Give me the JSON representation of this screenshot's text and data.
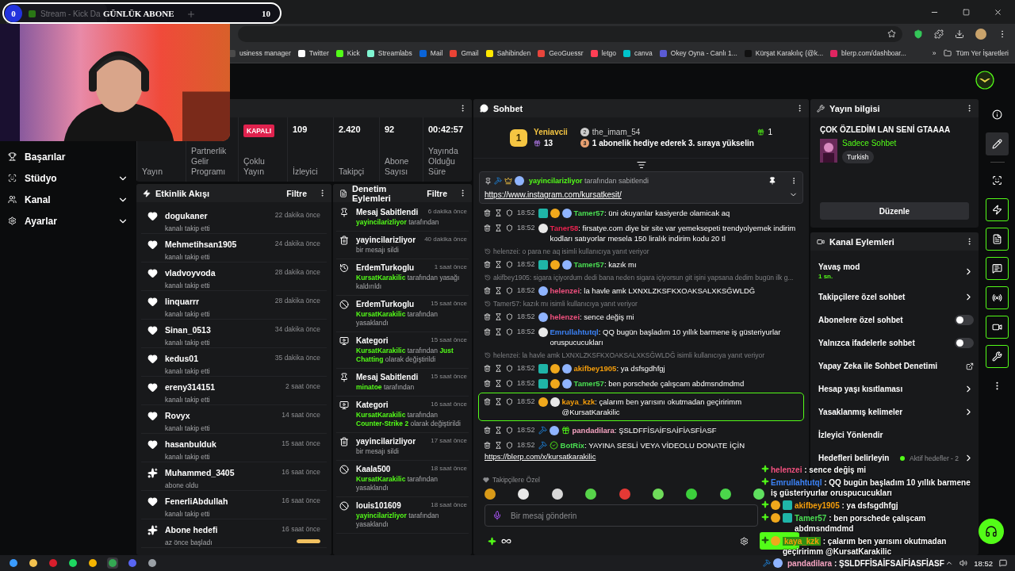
{
  "goal_overlay": {
    "current": "0",
    "label": "GÜNLÜK ABONE",
    "target": "10",
    "level": 0
  },
  "browser": {
    "tab_title": "Stream - Kick Da",
    "bookmarks": [
      {
        "label": "usiness manager",
        "color": "#4a4a4a"
      },
      {
        "label": "Twitter",
        "color": "#ffffff"
      },
      {
        "label": "Kick",
        "color": "#53fc18"
      },
      {
        "label": "Streamlabs",
        "color": "#80f5d2"
      },
      {
        "label": "Mail",
        "color": "#0a64d8"
      },
      {
        "label": "Gmail",
        "color": "#ea4335"
      },
      {
        "label": "Sahibinden",
        "color": "#ffe800"
      },
      {
        "label": "GeoGuessr",
        "color": "#e8453c"
      },
      {
        "label": "letgo",
        "color": "#ff3f55"
      },
      {
        "label": "canva",
        "color": "#00c4cc"
      },
      {
        "label": "Okey Oyna - Canlı 1...",
        "color": "#5b5bd6"
      },
      {
        "label": "Kürşat Karakılıç (@k...",
        "color": "#111111"
      },
      {
        "label": "blerp.com/dashboar...",
        "color": "#e02561"
      }
    ],
    "more": "»",
    "all_bookmarks": "Tüm Yer İşaretleri"
  },
  "sidebar": {
    "items": [
      {
        "label": "Başarılar",
        "expandable": false
      },
      {
        "label": "Stüdyo",
        "expandable": true
      },
      {
        "label": "Kanal",
        "expandable": true
      },
      {
        "label": "Ayarlar",
        "expandable": true
      }
    ]
  },
  "stats": {
    "cells": [
      {
        "kind": "text",
        "label": "Yayın"
      },
      {
        "kind": "text",
        "label": "Partnerlik Gelir Programı"
      },
      {
        "kind": "badge",
        "value": "KAPALI",
        "label": "Çoklu Yayın"
      },
      {
        "kind": "number",
        "value": "109",
        "label": "İzleyici"
      },
      {
        "kind": "number",
        "value": "2.420",
        "label": "Takipçi"
      },
      {
        "kind": "number",
        "value": "92",
        "label": "Abone Sayısı"
      },
      {
        "kind": "number",
        "value": "00:42:57",
        "label": "Yayında Olduğu Süre"
      }
    ]
  },
  "activity": {
    "title": "Etkinlik Akışı",
    "filter": "Filtre",
    "items": [
      {
        "kind": "follow",
        "name": "dogukaner",
        "detail": "kanalı takip etti",
        "time": "22 dakika önce"
      },
      {
        "kind": "follow",
        "name": "Mehmetihsan1905",
        "detail": "kanalı takip etti",
        "time": "24 dakika önce"
      },
      {
        "kind": "follow",
        "name": "vladvoyvoda",
        "detail": "kanalı takip etti",
        "time": "28 dakika önce"
      },
      {
        "kind": "follow",
        "name": "linquarrr",
        "detail": "kanalı takip etti",
        "time": "28 dakika önce"
      },
      {
        "kind": "follow",
        "name": "Sinan_0513",
        "detail": "kanalı takip etti",
        "time": "34 dakika önce"
      },
      {
        "kind": "follow",
        "name": "kedus01",
        "detail": "kanalı takip etti",
        "time": "35 dakika önce"
      },
      {
        "kind": "follow",
        "name": "ereny314151",
        "detail": "kanalı takip etti",
        "time": "2 saat önce"
      },
      {
        "kind": "follow",
        "name": "Rovyx",
        "detail": "kanalı takip etti",
        "time": "14 saat önce"
      },
      {
        "kind": "follow",
        "name": "hasanbulduk",
        "detail": "kanalı takip etti",
        "time": "15 saat önce"
      },
      {
        "kind": "subscription",
        "name": "Muhammed_3405",
        "detail": "abone oldu",
        "time": "16 saat önce"
      },
      {
        "kind": "follow",
        "name": "FenerliAbdullah",
        "detail": "kanalı takip etti",
        "time": "16 saat önce"
      },
      {
        "kind": "goal",
        "name": "Abone hedefi",
        "detail": "az önce başladı",
        "time": "16 saat önce",
        "level": 1
      }
    ]
  },
  "moderation": {
    "title": "Denetim Eylemleri",
    "filter": "Filtre",
    "items": [
      {
        "kind": "pin",
        "title": "Mesaj Sabitlendi",
        "time": "6 dakika önce",
        "detail": [
          {
            "text": "yayincilarizliyor",
            "highlight": true
          },
          {
            "text": " tarafından",
            "highlight": false
          }
        ]
      },
      {
        "kind": "delete",
        "title": "yayincilarizliyor",
        "time": "40 dakika önce",
        "detail": [
          {
            "text": "bir mesajı sildi",
            "highlight": false
          }
        ]
      },
      {
        "kind": "unban",
        "title": "ErdemTurkoglu",
        "time": "1 saat önce",
        "detail": [
          {
            "text": "KursatKarakilic",
            "highlight": true
          },
          {
            "text": " tarafından yasağı kaldırıldı",
            "highlight": false
          }
        ]
      },
      {
        "kind": "ban",
        "title": "ErdemTurkoglu",
        "time": "15 saat önce",
        "detail": [
          {
            "text": "KursatKarakilic",
            "highlight": true
          },
          {
            "text": " tarafından yasaklandı",
            "highlight": false
          }
        ]
      },
      {
        "kind": "category",
        "title": "Kategori",
        "time": "15 saat önce",
        "detail": [
          {
            "text": "KursatKarakilic",
            "highlight": true
          },
          {
            "text": " tarafından ",
            "highlight": false
          },
          {
            "text": "Just Chatting",
            "highlight": true
          },
          {
            "text": " olarak değiştirildi",
            "highlight": false
          }
        ]
      },
      {
        "kind": "pin",
        "title": "Mesaj Sabitlendi",
        "time": "15 saat önce",
        "detail": [
          {
            "text": "minatoe",
            "highlight": true
          },
          {
            "text": " tarafından",
            "highlight": false
          }
        ]
      },
      {
        "kind": "category",
        "title": "Kategori",
        "time": "16 saat önce",
        "detail": [
          {
            "text": "KursatKarakilic",
            "highlight": true
          },
          {
            "text": " tarafından ",
            "highlight": false
          },
          {
            "text": "Counter-Strike 2",
            "highlight": true
          },
          {
            "text": " olarak değiştirildi",
            "highlight": false
          }
        ]
      },
      {
        "kind": "delete",
        "title": "yayincilarizliyor",
        "time": "17 saat önce",
        "detail": [
          {
            "text": "bir mesajı sildi",
            "highlight": false
          }
        ]
      },
      {
        "kind": "ban",
        "title": "Kaala500",
        "time": "18 saat önce",
        "detail": [
          {
            "text": "KursatKarakilic",
            "highlight": true
          },
          {
            "text": " tarafından yasaklandı",
            "highlight": false
          }
        ]
      },
      {
        "kind": "ban",
        "title": "louis101609",
        "time": "18 saat önce",
        "detail": [
          {
            "text": "yayincilarizliyor",
            "highlight": true
          },
          {
            "text": " tarafından yasaklandı",
            "highlight": false
          }
        ]
      }
    ]
  },
  "chat": {
    "title": "Sohbet",
    "leaderboard": {
      "first": {
        "rank": "1",
        "name": "Yeniavcii",
        "count": "13"
      },
      "second": {
        "rank": "2",
        "name": "the_imam_54",
        "count": "1"
      },
      "prompt": {
        "rank": "3",
        "text": "1 abonelik hediye ederek 3. sıraya yükselin"
      }
    },
    "pinned": {
      "by": "yayincilarizliyor",
      "suffix": "tarafından sabitlendi",
      "link": "https://www.instagram.com/kursatkesit/"
    },
    "messages": [
      {
        "kind": "message",
        "time": "18:52",
        "badges": [
          {
            "kind": "sub"
          },
          {
            "kind": "coin"
          },
          {
            "kind": "face"
          }
        ],
        "user": "Tamer57",
        "color": "#4ade52",
        "text": ": üni okuyanlar kasiyerde olamicak aq",
        "highlighted": false
      },
      {
        "kind": "message",
        "time": "18:52",
        "badges": [
          {
            "kind": "panda"
          }
        ],
        "user": "Taner58",
        "color": "#e8234f",
        "text": ": firsatye.com diye bir site var yemeksepeti trendyolyemek indirim kodları satıyorlar mesela 150 liralık indirim kodu 20 tl",
        "highlighted": false
      },
      {
        "kind": "reply",
        "text": "helenzei: o para ne aq isimli kullanıcıya yanıt veriyor"
      },
      {
        "kind": "message",
        "time": "18:52",
        "badges": [
          {
            "kind": "sub"
          },
          {
            "kind": "coin"
          },
          {
            "kind": "face"
          }
        ],
        "user": "Tamer57",
        "color": "#4ade52",
        "text": ": kazık mı",
        "highlighted": false
      },
      {
        "kind": "reply",
        "text": "akifbey1905: sigara içiyordum dedi bana neden sigara içiyorsun git işini yapsana dedim bugün ilk g..."
      },
      {
        "kind": "message",
        "time": "18:52",
        "badges": [
          {
            "kind": "face"
          }
        ],
        "user": "helenzei",
        "color": "#f0507e",
        "text": ": la havle amk LXNXLZKSFKXOAKSALXKSĞWLDĞ",
        "highlighted": false
      },
      {
        "kind": "reply",
        "text": "Tamer57: kazık mı isimli kullanıcıya yanıt veriyor"
      },
      {
        "kind": "message",
        "time": "18:52",
        "badges": [
          {
            "kind": "face"
          }
        ],
        "user": "helenzei",
        "color": "#f0507e",
        "text": ": sence değiş mi",
        "highlighted": false
      },
      {
        "kind": "message",
        "time": "18:52",
        "badges": [
          {
            "kind": "panda"
          }
        ],
        "user": "Emrullahtutql",
        "color": "#3b82f6",
        "text": ": QQ bugün başladım 10 yıllık barmene iş güsteriyurlar oruspucucukları",
        "highlighted": false
      },
      {
        "kind": "reply",
        "text": "helenzei: la havle amk LXNXLZKSFKXOAKSALXKSĞWLDĞ isimli kullanıcıya yanıt veriyor"
      },
      {
        "kind": "message",
        "time": "18:52",
        "badges": [
          {
            "kind": "sub"
          },
          {
            "kind": "coin"
          },
          {
            "kind": "face"
          }
        ],
        "user": "akifbey1905",
        "color": "#f59e0b",
        "text": ": ya dsfsgdhfgj",
        "highlighted": false
      },
      {
        "kind": "message",
        "time": "18:52",
        "badges": [
          {
            "kind": "sub"
          },
          {
            "kind": "coin"
          },
          {
            "kind": "face"
          }
        ],
        "user": "Tamer57",
        "color": "#4ade52",
        "text": ": ben porschede çalışcam abdmsndmdmd",
        "highlighted": false
      },
      {
        "kind": "message",
        "time": "18:52",
        "badges": [
          {
            "kind": "coin"
          },
          {
            "kind": "panda"
          }
        ],
        "user": "kaya_kzk",
        "color": "#f59e0b",
        "text": ": çalarım ben yarısını okutmadan geçiririmm @KursatKarakilic",
        "highlighted": true
      },
      {
        "kind": "message",
        "time": "18:52",
        "badges": [
          {
            "kind": "mod"
          },
          {
            "kind": "face"
          },
          {
            "kind": "gift"
          }
        ],
        "user": "pandadilara",
        "color": "#f4a3c0",
        "text": ": ŞSLDFFİSAİFSAİFİASFİASF",
        "highlighted": false
      },
      {
        "kind": "message",
        "time": "18:52",
        "badges": [
          {
            "kind": "mod"
          },
          {
            "kind": "verified"
          }
        ],
        "user": "BotRix",
        "color": "#4ade52",
        "text": ": YAYINA SESLİ VEYA VİDEOLU DONATE İÇİN",
        "link": "https://blerp.com/x/kursatkarakilic",
        "highlighted": false
      }
    ],
    "followers_only": "Takipçilere Özel",
    "emotes": [
      {
        "color": "#d99a18"
      },
      {
        "color": "#e8e8e8"
      },
      {
        "color": "#d8d8d8"
      },
      {
        "color": "#57d44a"
      },
      {
        "color": "#e53935"
      },
      {
        "color": "#6fdc5a"
      },
      {
        "color": "#3ccf3c"
      },
      {
        "color": "#4bd64b"
      },
      {
        "color": "#5fe05f"
      }
    ],
    "input": {
      "placeholder": "Bir mesaj gönderin"
    }
  },
  "stream_info": {
    "title": "Yayın bilgisi",
    "stream_title": "ÇOK ÖZLEDİM LAN SENİ GTAAAA",
    "category": "Sadece Sohbet",
    "tag": "Turkish",
    "edit": "Düzenle"
  },
  "channel_actions": {
    "title": "Kanal Eylemleri",
    "items": [
      {
        "kind": "link",
        "label": "Yavaş mod",
        "detail": "1 sn."
      },
      {
        "kind": "link",
        "label": "Takipçilere özel sohbet"
      },
      {
        "kind": "toggle",
        "label": "Abonelere özel sohbet",
        "on": false
      },
      {
        "kind": "toggle",
        "label": "Yalnızca ifadelerle sohbet",
        "on": false
      },
      {
        "kind": "external",
        "label": "Yapay Zeka ile Sohbet Denetimi"
      },
      {
        "kind": "link",
        "label": "Hesap yaşı kısıtlaması"
      },
      {
        "kind": "link",
        "label": "Yasaklanmış kelimeler"
      },
      {
        "kind": "plain",
        "label": "İzleyici Yönlendir"
      },
      {
        "kind": "link",
        "label": "Hedefleri belirleyin",
        "status": "Aktif hedefler - 2"
      }
    ]
  },
  "rail": {
    "items": [
      {
        "kind": "info",
        "selected": false
      },
      {
        "kind": "edit",
        "selected": true
      },
      {
        "kind": "camera",
        "selected": false
      },
      {
        "kind": "activity",
        "selected": true
      },
      {
        "kind": "log",
        "selected": true
      },
      {
        "kind": "chat",
        "selected": true
      },
      {
        "kind": "broadcast",
        "selected": true
      },
      {
        "kind": "video",
        "selected": true
      },
      {
        "kind": "tools",
        "selected": true
      },
      {
        "kind": "more",
        "selected": false
      }
    ]
  },
  "overlay_chat": [
    {
      "user": "helenzei",
      "color": "#f0507e",
      "text": " : sence değiş mi",
      "highlighted": false
    },
    {
      "user": "Emrullahtutql",
      "color": "#3b82f6",
      "text": " : QQ bugün başladım 10 yıllık barmene iş güsteriyurlar oruspucucukları",
      "highlighted": false
    },
    {
      "user": "akifbey1905",
      "color": "#f59e0b",
      "text": " : ya dsfsgdhfgj",
      "badges": [
        {
          "kind": "coin"
        },
        {
          "kind": "sub"
        }
      ],
      "highlighted": false
    },
    {
      "user": "Tamer57",
      "color": "#4ade52",
      "text": " : ben porschede çalışcam abdmsndmdmd",
      "badges": [
        {
          "kind": "coin"
        },
        {
          "kind": "sub"
        }
      ],
      "highlighted": false
    },
    {
      "user": "kaya_kzk",
      "color": "#f59e0b",
      "text": " : çalarım ben yarısını okutmadan geçiririmm @KursatKarakilic",
      "badges": [
        {
          "kind": "coin"
        }
      ],
      "highlighted": true
    }
  ],
  "overlay_last": {
    "user": "pandadilara",
    "color": "#f4a3c0",
    "text": " : ŞSLDFFİSAİFSAİFİASFİASF"
  },
  "taskbar": {
    "apps": [
      {
        "color": "#3b9cff",
        "selected": false
      },
      {
        "color": "#f2c14e",
        "selected": false
      },
      {
        "color": "#d81e2c",
        "selected": false
      },
      {
        "color": "#1ed760",
        "selected": false
      },
      {
        "color": "#f4b400",
        "selected": false
      },
      {
        "color": "#34a853",
        "selected": true
      },
      {
        "color": "#5865f2",
        "selected": false
      },
      {
        "color": "#9aa0a6",
        "selected": false
      }
    ],
    "clock": "18:52"
  }
}
